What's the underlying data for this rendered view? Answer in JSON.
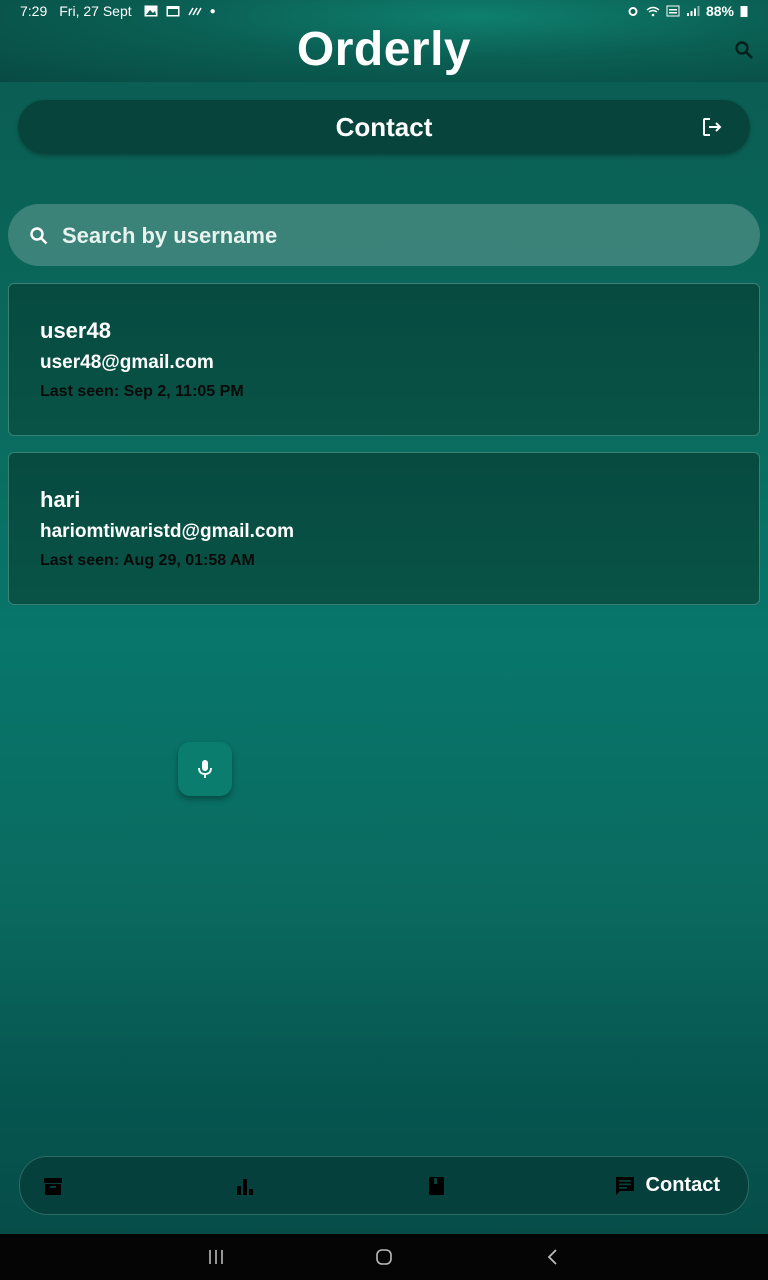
{
  "status_bar": {
    "time": "7:29",
    "date": "Fri, 27 Sept",
    "battery": "88%"
  },
  "app": {
    "title": "Orderly"
  },
  "header": {
    "title": "Contact"
  },
  "search": {
    "placeholder": "Search by username"
  },
  "contacts": [
    {
      "username": "user48",
      "email": "user48@gmail.com",
      "last_seen": "Last seen: Sep 2, 11:05 PM"
    },
    {
      "username": "hari",
      "email": "hariomtiwaristd@gmail.com",
      "last_seen": "Last seen: Aug 29, 01:58 AM"
    }
  ],
  "bottom_nav": {
    "items": [
      {
        "icon": "archive-icon"
      },
      {
        "icon": "bar-chart-icon"
      },
      {
        "icon": "book-icon"
      },
      {
        "icon": "chat-icon",
        "label": "Contact",
        "active": true
      }
    ]
  },
  "colors": {
    "background_top": "#0b5a50",
    "background_mid": "#08766b",
    "card": "#074a40",
    "header_bar": "#07443b",
    "fab": "#0b7d6e"
  }
}
